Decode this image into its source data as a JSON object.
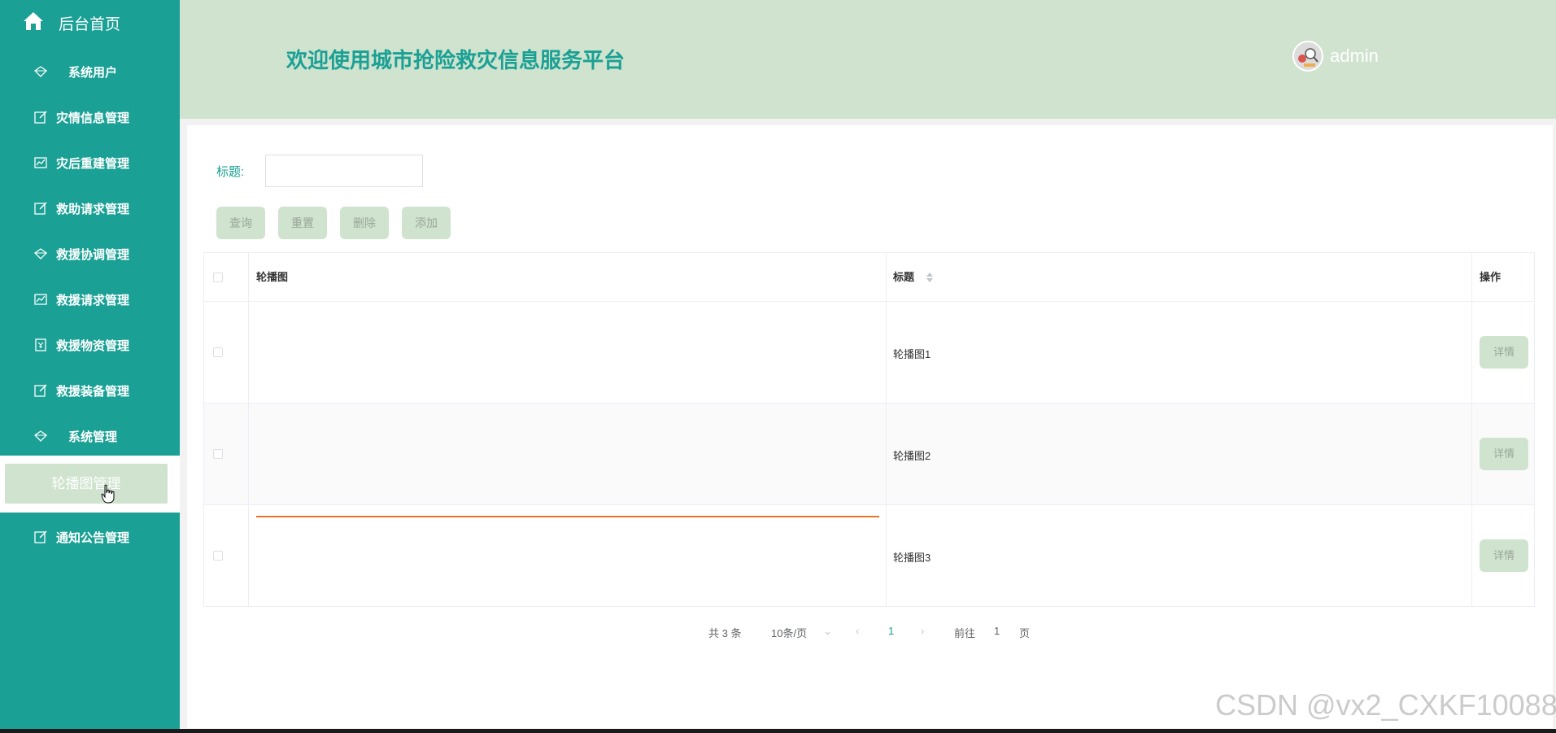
{
  "sidebar": {
    "home_label": "后台首页",
    "items": [
      {
        "label": "系统用户",
        "icon": "diamond-icon"
      },
      {
        "label": "灾情信息管理",
        "icon": "edit-icon"
      },
      {
        "label": "灾后重建管理",
        "icon": "chart-icon"
      },
      {
        "label": "救助请求管理",
        "icon": "edit-icon"
      },
      {
        "label": "救援协调管理",
        "icon": "diamond-icon"
      },
      {
        "label": "救援请求管理",
        "icon": "chart-icon"
      },
      {
        "label": "救援物资管理",
        "icon": "badge-icon"
      },
      {
        "label": "救援装备管理",
        "icon": "edit-icon"
      },
      {
        "label": "系统管理",
        "icon": "diamond-icon"
      },
      {
        "label": "通知公告管理",
        "icon": "edit-icon"
      }
    ],
    "active_submenu": "轮播图管理"
  },
  "header": {
    "welcome": "欢迎使用城市抢险救灾信息服务平台",
    "username": "admin"
  },
  "search": {
    "label": "标题:",
    "value": ""
  },
  "buttons": {
    "query": "查询",
    "reset": "重置",
    "delete": "删除",
    "add": "添加"
  },
  "table": {
    "headers": {
      "image": "轮播图",
      "title": "标题",
      "actions": "操作"
    },
    "rows": [
      {
        "title": "轮播图1",
        "action": "详情"
      },
      {
        "title": "轮播图2",
        "action": "详情"
      },
      {
        "title": "轮播图3",
        "action": "详情"
      }
    ]
  },
  "pagination": {
    "total": "共 3 条",
    "page_size": "10条/页",
    "current": "1",
    "goto_prefix": "前往",
    "goto_value": "1",
    "goto_suffix": "页"
  },
  "watermark": "CSDN @vx2_CXKF10088",
  "colors": {
    "accent": "#1aa094",
    "header_bg": "#cfe3cf",
    "button_bg": "#cfe3cf",
    "line": "#e8742a"
  }
}
